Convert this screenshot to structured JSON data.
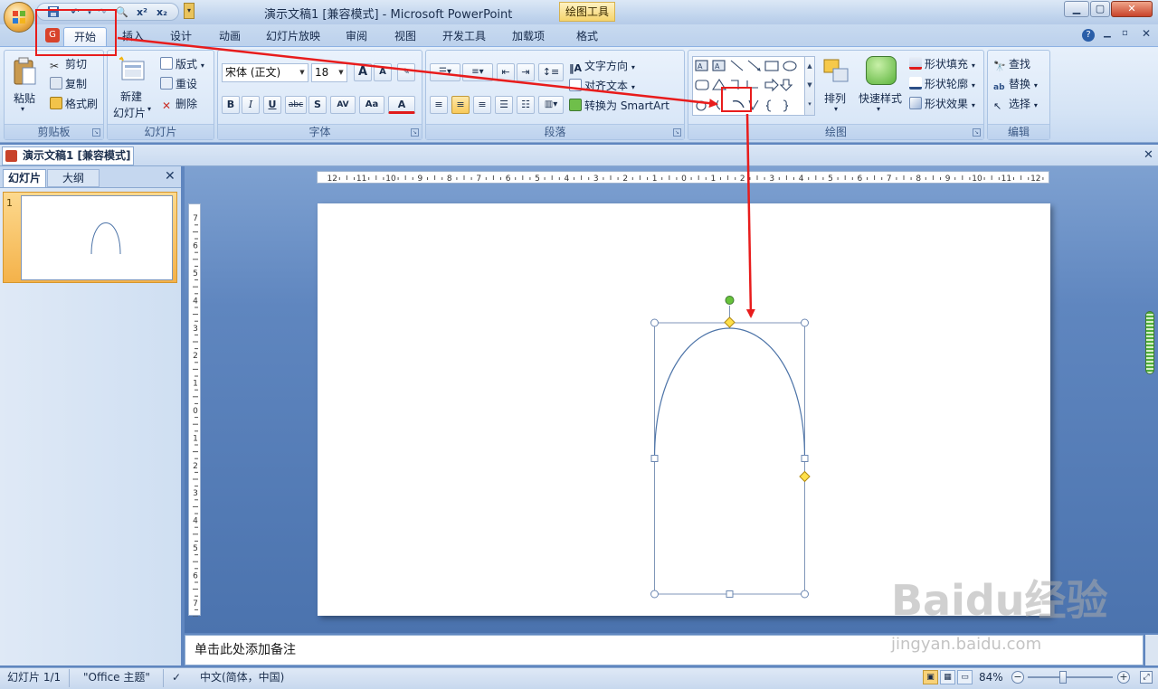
{
  "window": {
    "title": "演示文稿1 [兼容模式] - Microsoft PowerPoint",
    "contextual_tab": "绘图工具",
    "controls": {
      "minimize": "▁",
      "maximize": "▢",
      "close": "✕"
    }
  },
  "quick_access": {
    "items": [
      "save-icon",
      "undo-icon",
      "redo-icon",
      "print-preview-icon",
      "superscript-icon",
      "subscript-icon"
    ],
    "superscript": "x²",
    "subscript": "x₂"
  },
  "tabs": [
    {
      "label": "开始",
      "active": true
    },
    {
      "label": "插入"
    },
    {
      "label": "设计"
    },
    {
      "label": "动画"
    },
    {
      "label": "幻灯片放映"
    },
    {
      "label": "审阅"
    },
    {
      "label": "视图"
    },
    {
      "label": "开发工具"
    },
    {
      "label": "加载项"
    },
    {
      "label": "格式"
    }
  ],
  "ribbon": {
    "clipboard": {
      "label": "剪贴板",
      "paste": "粘贴",
      "cut": "剪切",
      "copy": "复制",
      "format_painter": "格式刷"
    },
    "slides": {
      "label": "幻灯片",
      "new_slide_line1": "新建",
      "new_slide_line2": "幻灯片",
      "layout": "版式",
      "reset": "重设",
      "delete": "删除"
    },
    "font": {
      "label": "字体",
      "font_name": "宋体 (正文)",
      "font_size": "18",
      "grow": "A",
      "shrink": "A",
      "bold": "B",
      "italic": "I",
      "underline": "U",
      "strike": "abc",
      "shadow": "S",
      "spacing": "AV",
      "case": "Aa",
      "color": "A"
    },
    "paragraph": {
      "label": "段落",
      "text_direction": "文字方向",
      "align_text": "对齐文本",
      "convert_smartart": "转换为 SmartArt"
    },
    "drawing": {
      "label": "绘图",
      "arrange": "排列",
      "quick_styles": "快速样式",
      "shape_fill": "形状填充",
      "shape_outline": "形状轮廓",
      "shape_effects": "形状效果"
    },
    "editing": {
      "label": "编辑",
      "find": "查找",
      "replace": "替换",
      "select": "选择"
    }
  },
  "document_tab": {
    "label": "演示文稿1 [兼容模式]"
  },
  "slides_pane": {
    "tabs": [
      "幻灯片",
      "大纲"
    ],
    "thumbnails": [
      {
        "number": "1"
      }
    ]
  },
  "rulers": {
    "horizontal": [
      "12",
      "11",
      "10",
      "9",
      "8",
      "7",
      "6",
      "5",
      "4",
      "3",
      "2",
      "1",
      "0",
      "1",
      "2",
      "3",
      "4",
      "5",
      "6",
      "7",
      "8",
      "9",
      "10",
      "11",
      "12"
    ],
    "vertical": [
      "7",
      "6",
      "5",
      "4",
      "3",
      "2",
      "1",
      "0",
      "1",
      "2",
      "3",
      "4",
      "5",
      "6",
      "7"
    ]
  },
  "notes": {
    "placeholder": "单击此处添加备注"
  },
  "status_bar": {
    "slide_info": "幻灯片 1/1",
    "theme": "\"Office 主题\"",
    "language": "中文(简体，中国)",
    "zoom": "84%",
    "zoom_fraction": 0.4
  },
  "watermark": {
    "text": "Baidu经验",
    "url": "jingyan.baidu.com"
  },
  "colors": {
    "annotation_red": "#e81c1c",
    "shape_stroke": "#4d74a8",
    "handle_green": "#67c23a",
    "handle_yellow": "#ffe04a"
  }
}
